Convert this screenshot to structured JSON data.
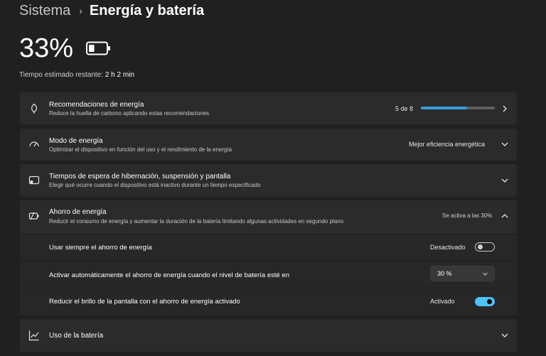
{
  "breadcrumb": {
    "parent": "Sistema",
    "separator": "›",
    "current": "Energía y batería"
  },
  "battery": {
    "percent_text": "33%",
    "level": 0.33,
    "remaining_label": "Tiempo estimado restante:",
    "remaining_value": "2 h 2 min"
  },
  "rows": {
    "recommendations": {
      "title": "Recomendaciones de energía",
      "subtitle": "Reduce la huella de carbono aplicando estas recomendaciones",
      "count_text": "5 de 8",
      "progress": 0.625
    },
    "power_mode": {
      "title": "Modo de energía",
      "subtitle": "Optimizar el dispositivo en función del uso y el rendimiento de la energía",
      "value": "Mejor eficiencia energética"
    },
    "sleep": {
      "title": "Tiempos de espera de hibernación, suspensión y pantalla",
      "subtitle": "Elegir qué ocurre cuando el dispositivo está inactivo durante un tiempo especificado"
    },
    "saver": {
      "title": "Ahorro de energía",
      "subtitle": "Reducir el consumo de energía y aumentar la duración de la batería limitando algunas actividades en segundo plano",
      "status": "Se activa a las 30%"
    },
    "usage": {
      "title": "Uso de la batería"
    }
  },
  "saver_options": {
    "always": {
      "label": "Usar siempre el ahorro de energía",
      "state_text": "Desactivado",
      "on": false
    },
    "auto": {
      "label": "Activar automáticamente el ahorro de energía cuando el nivel de batería esté en",
      "value": "30 %"
    },
    "brightness": {
      "label": "Reducir el brillo de la pantalla con el ahorro de energía activado",
      "state_text": "Activado",
      "on": true
    }
  },
  "colors": {
    "accent": "#4cc2ff",
    "progress": "#3a9bd9",
    "background": "#202020",
    "card": "#2b2b2b"
  },
  "icons": [
    "leaf-icon",
    "gauge-icon",
    "screen-sleep-icon",
    "battery-saver-icon",
    "chart-line-icon",
    "chevron-right-icon",
    "chevron-down-icon",
    "chevron-up-icon",
    "battery-icon"
  ]
}
